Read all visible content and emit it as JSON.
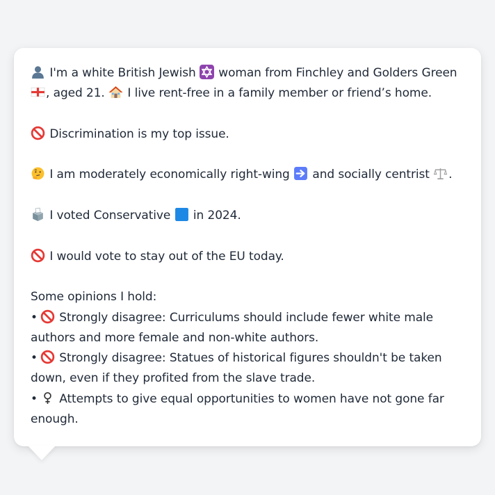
{
  "profile": {
    "intro_a": "I'm a white British Jewish",
    "intro_b": "woman from Finchley and Golders Green",
    "intro_c": ",",
    "intro_d": "aged 21.",
    "intro_e": "I live rent-free in a family member or friend’s home.",
    "issue": "Discrimination is my top issue.",
    "politics_a": "I am moderately economically right-wing",
    "politics_b": "and socially centrist",
    "politics_c": ".",
    "vote_a": "I voted Conservative",
    "vote_b": "in 2024.",
    "eu": "I would vote to stay out of the EU today.",
    "opinions_heading": "Some opinions I hold:",
    "bullet": "•",
    "opinions": [
      "Strongly disagree: Curriculums should include fewer white male authors and more female and non-white authors.",
      "Strongly disagree: Statues of historical figures shouldn't be taken down, even if they profited from the slave trade.",
      "Attempts to give equal opportunities to women have not gone far enough."
    ]
  },
  "icons": {
    "person": "person-silhouette-icon",
    "star_of_david": "star-of-david-icon",
    "england_flag": "england-flag-icon",
    "house": "house-icon",
    "prohibited": "prohibited-icon",
    "thinking_face": "thinking-face-icon",
    "right_arrow": "right-arrow-icon",
    "scales": "balance-scale-icon",
    "ballot_box": "ballot-box-icon",
    "blue_square": "blue-square-icon",
    "female_sign": "female-sign-icon"
  },
  "colors": {
    "background": "#f3f4f6",
    "card": "#ffffff",
    "text": "#1f2937",
    "conservative_blue": "#1e88e5",
    "prohibited_red": "#e53935",
    "star_purple": "#8e44ad"
  }
}
